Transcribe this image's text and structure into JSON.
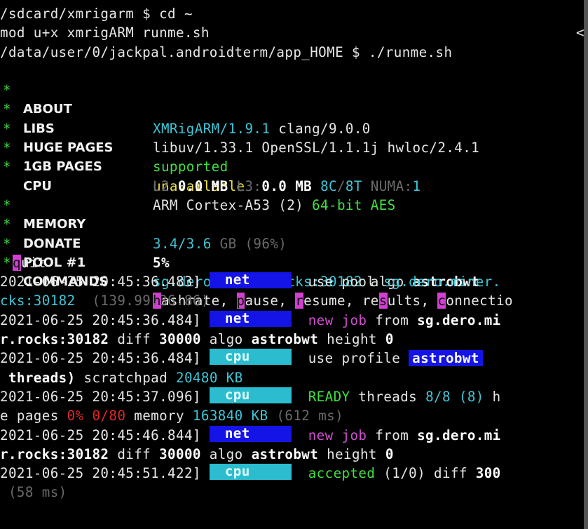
{
  "terminal": {
    "lines": {
      "l0": "/sdcard/xmrigarm $ cd ~",
      "l1": "mod u+x xmrigARM runme.sh",
      "l1_tail": "<",
      "l2": "/data/user/0/jackpal.androidterm/app_HOME $ ./runme.sh"
    },
    "info": {
      "about_label": "ABOUT",
      "about_name": "XMRigARM/1.9.1",
      "about_rest": " clang/9.0.0",
      "libs_label": "LIBS",
      "libs_value": "libuv/1.33.1 OpenSSL/1.1.1j hwloc/2.4.1",
      "huge_label": "HUGE PAGES",
      "huge_value": "supported",
      "gb_label": "1GB PAGES",
      "gb_value": "unavailable",
      "cpu_label": "CPU",
      "cpu_value": "ARM Cortex-A53 (2) ",
      "cpu_flags": "64-bit AES",
      "l2_label": "L2:",
      "l2_value": "0.0 MB ",
      "l3_label": "L3:",
      "l3_value": "0.0 MB ",
      "cores": "8C",
      "slash": "/",
      "threads": "8T",
      "numa_label": " NUMA:",
      "numa_value": "1",
      "mem_label": "MEMORY",
      "mem_value": "3.4/3.6",
      "mem_unit": " GB ",
      "mem_pct": "(96%)",
      "donate_label": "DONATE",
      "donate_value": "5%",
      "pool_label": "POOL #1",
      "pool_host": "sg.dero.miner.rocks:30182",
      "pool_algo_word": " algo ",
      "pool_algo": "astrobwt",
      "cmd_label": "COMMANDS",
      "cmd_h": "h",
      "cmd_hashrate": "ashrate, ",
      "cmd_p": "p",
      "cmd_pause": "ause, ",
      "cmd_r": "r",
      "cmd_resume": "esume, ",
      "cmd_re": "re",
      "cmd_s": "s",
      "cmd_ults": "ults, ",
      "cmd_c": "c",
      "cmd_onnection": "onnectio",
      "quit_q": "q",
      "quit_rest": "uit",
      "star": "*"
    },
    "log": {
      "t1": "2021-06-25 20:45:36.483]",
      "net": "net",
      "cpu": "cpu",
      "use_pool": "use pool ",
      "pool_short": "sg.dero.miner.",
      "cont1_host": "cks:30182",
      "cont1_ip": "  (139.99.36.86)",
      "t2": "2021-06-25 20:45:36.484]",
      "new_word": "new",
      "job_word": "job",
      "from_word": " from ",
      "from_host": "sg.dero.mi",
      "cont2_host": "r.rocks:30182",
      "diff_word": " diff ",
      "diff_value": "30000",
      "algo_word": " algo ",
      "algo_value": "astrobwt",
      "height_word": " height ",
      "height_value": "0",
      "t3": "2021-06-25 20:45:36.484]",
      "use_profile": "use profile ",
      "profile": "astrobwt",
      "threads_tail": " threads)",
      "scratchpad": " scratchpad ",
      "scratch_value": "20480 KB",
      "t4": "2021-06-25 20:45:37.096]",
      "ready": "READY",
      "threads_word": " threads ",
      "threads_value": "8/8",
      "threads_paren": " (8)",
      "h_tail": " h",
      "pages_word": "e pages ",
      "pages_pct": "0%",
      "pages_ratio": "0/80",
      "memory_word": " memory ",
      "memory_value": "163840 KB",
      "memory_ms": " (612 ms)",
      "t5": "2021-06-25 20:45:46.844]",
      "t6": "2021-06-25 20:45:51.422]",
      "accepted": "accepted",
      "accepted_count": " (1/0)",
      "accepted_diff_word": " diff ",
      "accepted_diff": "300",
      "last_ms": " (58 ms)"
    }
  }
}
